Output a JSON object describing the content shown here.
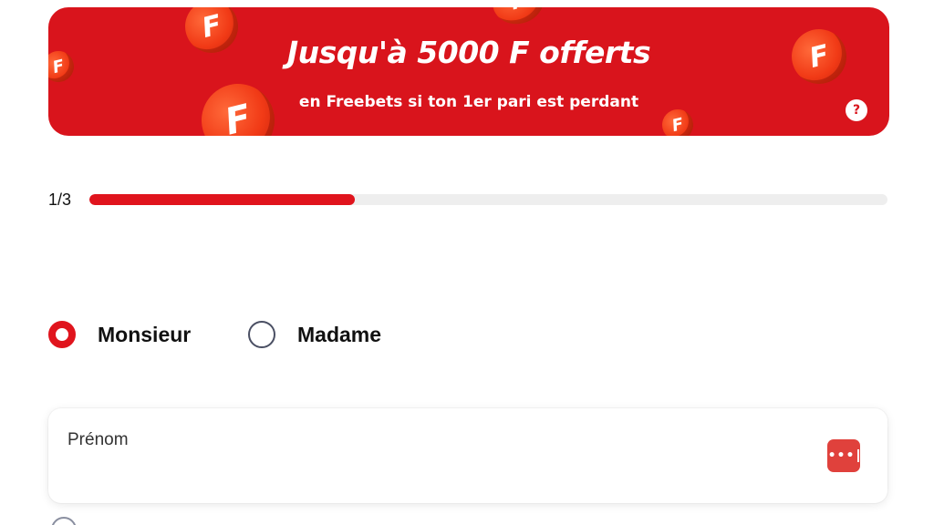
{
  "banner": {
    "title": "Jusqu'à 5000 F offerts",
    "subtitle": "en Freebets si ton 1er pari est perdant",
    "background_color": "#d9141c",
    "coin_letter": "F",
    "help_label": "?"
  },
  "progress": {
    "step_label": "1/3",
    "fraction": 0.333,
    "fill_color": "#e0141d"
  },
  "civility": {
    "options": [
      {
        "label": "Monsieur",
        "checked": true
      },
      {
        "label": "Madame",
        "checked": false
      }
    ]
  },
  "first_name_field": {
    "label": "Prénom",
    "value": "",
    "icon": "password-manager-icon",
    "icon_color": "#e0413c"
  }
}
